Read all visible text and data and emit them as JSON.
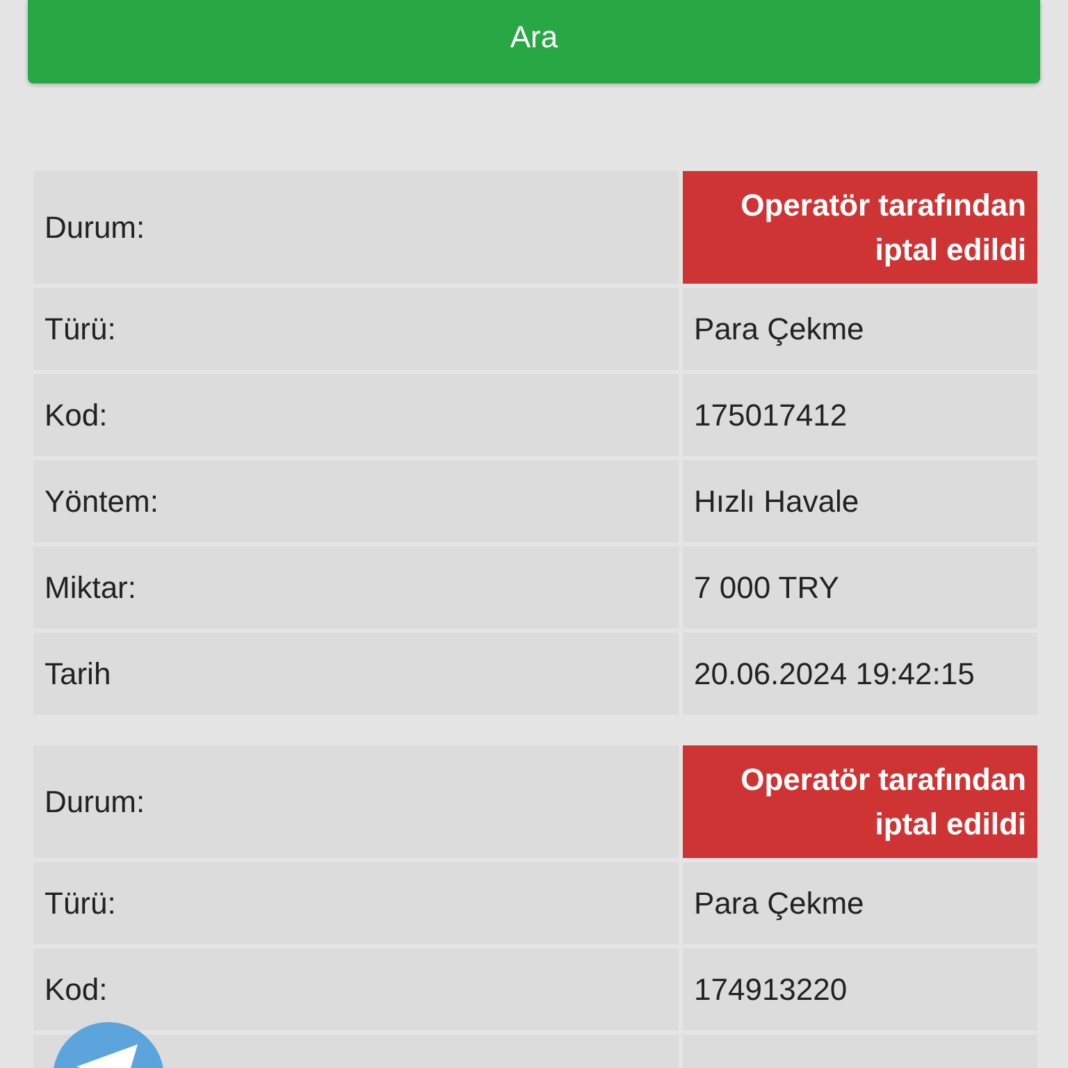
{
  "search_button": "Ara",
  "transactions": [
    {
      "rows": [
        {
          "label": "Durum:",
          "value": "Operatör tarafından iptal edildi",
          "kind": "status"
        },
        {
          "label": "Türü:",
          "value": "Para Çekme",
          "kind": "text"
        },
        {
          "label": "Kod:",
          "value": "175017412",
          "kind": "text"
        },
        {
          "label": "Yöntem:",
          "value": "Hızlı Havale",
          "kind": "text"
        },
        {
          "label": "Miktar:",
          "value": "7 000 TRY",
          "kind": "text"
        },
        {
          "label": "Tarih",
          "value": "20.06.2024 19:42:15",
          "kind": "text"
        }
      ]
    },
    {
      "rows": [
        {
          "label": "Durum:",
          "value": "Operatör tarafından iptal edildi",
          "kind": "status"
        },
        {
          "label": "Türü:",
          "value": "Para Çekme",
          "kind": "text"
        },
        {
          "label": "Kod:",
          "value": "174913220",
          "kind": "text"
        },
        {
          "kind": "cut"
        }
      ]
    }
  ]
}
